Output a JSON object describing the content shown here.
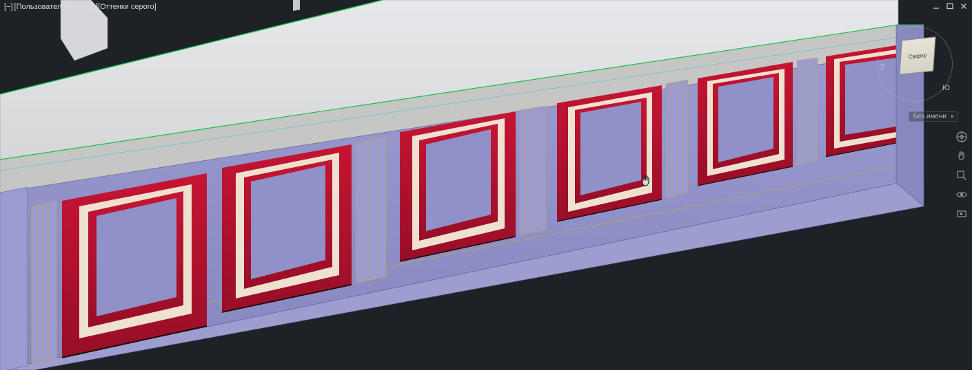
{
  "viewport": {
    "minimized_symbol": "[−]",
    "view_control": "[Пользовательский вид]",
    "visual_style": "[Оттенки серого]"
  },
  "window_controls": {
    "minimize": "—",
    "maximize": "❐",
    "close": "✕"
  },
  "viewcube": {
    "face_label": "Сверху",
    "west": "З",
    "south": "Ю",
    "brand": ""
  },
  "layout_selector": {
    "label": "Без имени"
  },
  "nav_bar": {
    "items": [
      {
        "name": "full-nav-wheel-icon"
      },
      {
        "name": "pan-icon"
      },
      {
        "name": "zoom-extents-icon"
      },
      {
        "name": "orbit-icon"
      },
      {
        "name": "showmotion-icon"
      }
    ]
  },
  "colors": {
    "bg": "#1e2226",
    "panel_lilac": "#8f90c7",
    "panel_lilac_dark": "#7a7bb5",
    "molding_red": "#b6122f",
    "molding_red_dark": "#8f0e26",
    "molding_cream": "#efe1d0",
    "counter_top": "#dedfe2",
    "counter_front": "#c9c9c8",
    "edge_green": "#16c24a",
    "edge_cyan": "#2cc0d9",
    "gold": "#c7a24a"
  }
}
